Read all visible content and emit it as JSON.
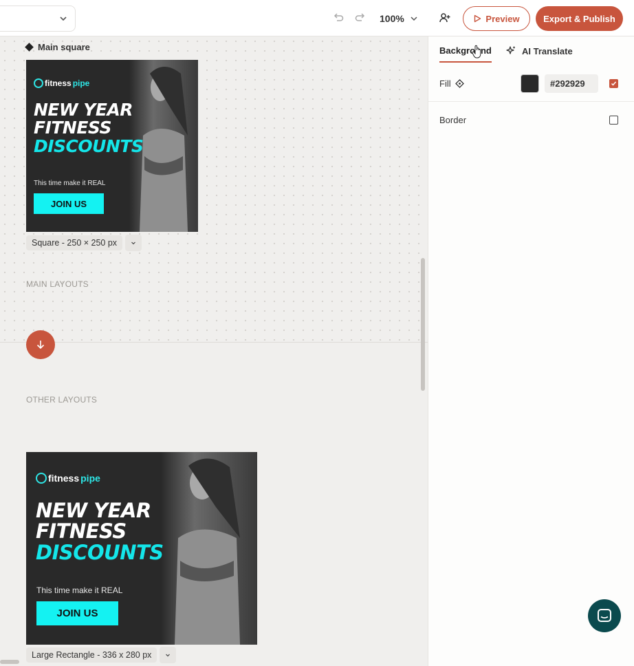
{
  "topbar": {
    "zoom_label": "100%",
    "preview_label": "Preview",
    "export_label": "Export & Publish"
  },
  "canvas": {
    "frame_title": "Main square",
    "main_size_label": "Square - 250 × 250 px",
    "main_layouts_label": "MAIN LAYOUTS",
    "other_layouts_label": "OTHER LAYOUTS",
    "large_size_label": "Large Rectangle - 336 x 280 px"
  },
  "banner": {
    "logo_text": "fitness",
    "logo_accent": "pipe",
    "line1": "NEW YEAR",
    "line2": "FITNESS",
    "line3": "DISCOUNTS",
    "tagline": "This time make it REAL",
    "cta": "JOIN US",
    "bg_color": "#292929",
    "accent_color": "#14e6ea"
  },
  "panel": {
    "tab_background": "Background",
    "tab_ai": "AI Translate",
    "fill_label": "Fill",
    "fill_hex": "#292929",
    "border_label": "Border",
    "fill_enabled": true,
    "border_enabled": false
  },
  "icons": {
    "undo": "undo-icon",
    "redo": "redo-icon",
    "add_user": "add-user-icon",
    "play": "play-icon",
    "sparkle": "sparkle-icon",
    "chat": "chat-icon"
  }
}
